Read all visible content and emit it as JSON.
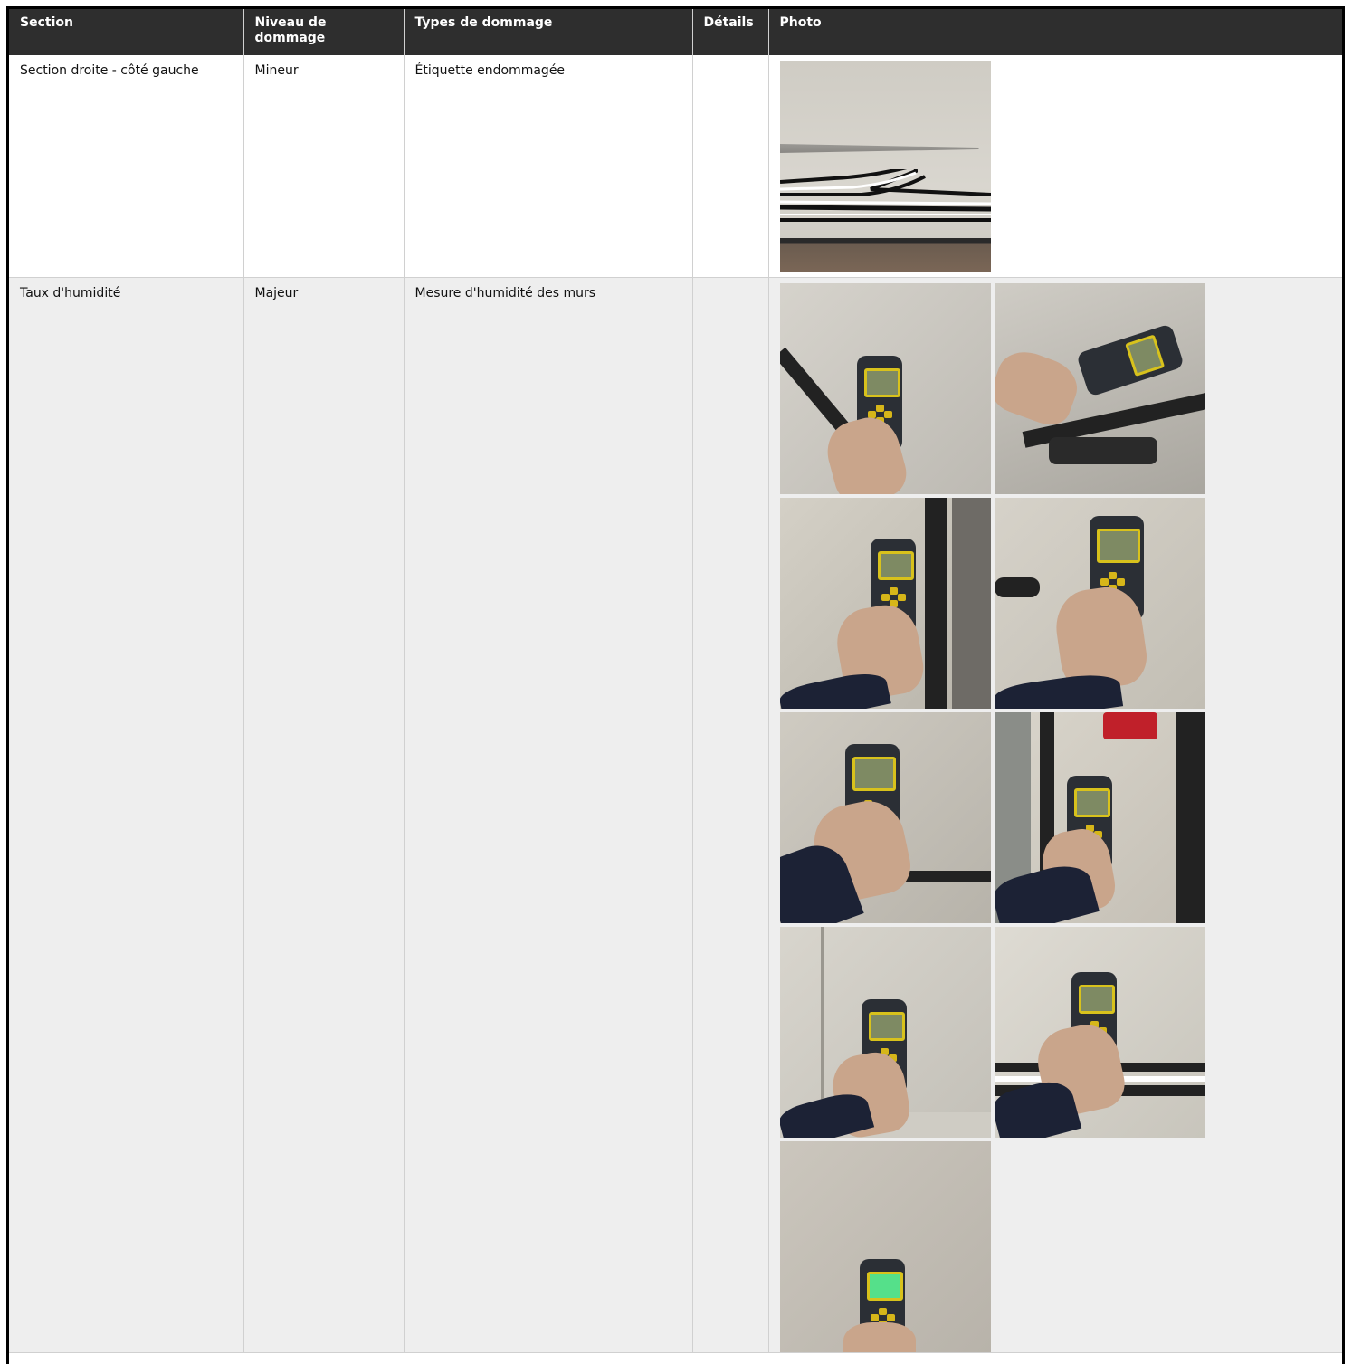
{
  "table": {
    "headers": {
      "section": "Section",
      "level": "Niveau de dommage",
      "types": "Types de dommage",
      "details": "Détails",
      "photo": "Photo"
    },
    "rows": [
      {
        "section": "Section droite - côté gauche",
        "level": "Mineur",
        "types": "Étiquette endommagée",
        "details": "",
        "photos": [
          "decal-damage-photo"
        ]
      },
      {
        "section": "Taux d'humidité",
        "level": "Majeur",
        "types": "Mesure d'humidité des murs",
        "details": "",
        "photos": [
          "moisture-meter-photo",
          "moisture-meter-photo",
          "moisture-meter-photo",
          "moisture-meter-photo",
          "moisture-meter-photo",
          "moisture-meter-photo",
          "moisture-meter-photo",
          "moisture-meter-photo",
          "moisture-meter-photo"
        ]
      }
    ]
  }
}
